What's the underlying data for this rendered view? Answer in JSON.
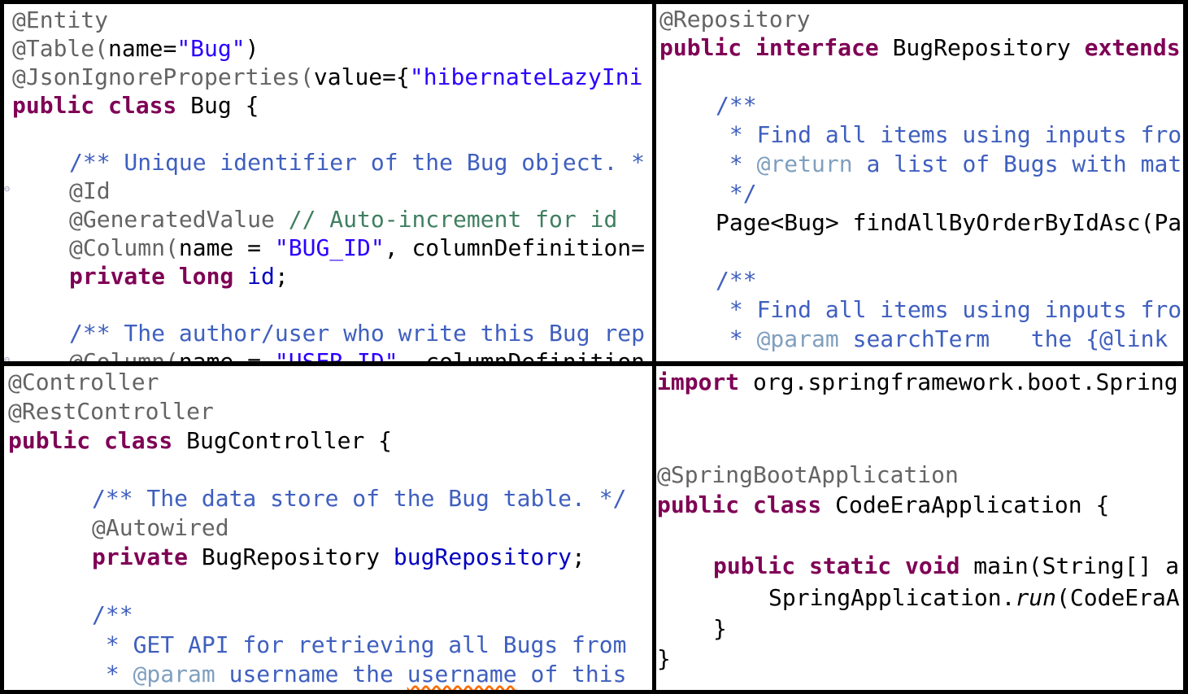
{
  "panels": {
    "entity": {
      "l1": "@Entity",
      "l2a": "@Table(",
      "l2b": "name=",
      "l2c": "\"Bug\"",
      "l2d": ")",
      "l3a": "@JsonIgnoreProperties(",
      "l3b": "value={",
      "l3c": "\"hibernateLazyIni",
      "l4a": "public class",
      "l4b": " Bug {",
      "l5": "/** Unique identifier of the Bug object. *",
      "l6": "@Id",
      "l7a": "@GeneratedValue",
      "l7b": " // Auto-increment for id",
      "l8a": "@Column(",
      "l8b": "name = ",
      "l8c": "\"BUG_ID\"",
      "l8d": ", columnDefinition=",
      "l9a": "private long",
      "l9b": " id",
      "l9c": ";",
      "l10": "/** The author/user who write this Bug rep",
      "l11a": "@Column(",
      "l11b": "name = ",
      "l11c": "\"USER_ID\"",
      "l11d": ", columnDefinition"
    },
    "repository": {
      "l1": "@Repository",
      "l2a": "public interface",
      "l2b": " BugRepository ",
      "l2c": "extends",
      "l3": "/**",
      "l4": " * Find all items using inputs fro",
      "l5a": " * ",
      "l5b": "@return",
      "l5c": " a list of Bugs with mat",
      "l6": " */",
      "l7": "Page<Bug> findAllByOrderByIdAsc(Pa",
      "l8": "/**",
      "l9": " * Find all items using inputs fro",
      "l10a": " * ",
      "l10b": "@param",
      "l10c": " searchTerm   the {@link "
    },
    "controller": {
      "l1": "@Controller",
      "l2": "@RestController",
      "l3a": "public class",
      "l3b": " BugController {",
      "l4": "/** The data store of the Bug table. */",
      "l5": "@Autowired",
      "l6a": "private",
      "l6b": " BugRepository ",
      "l6c": "bugRepository",
      "l6d": ";",
      "l7": "/**",
      "l8": " * GET API for retrieving all Bugs from",
      "l9a": " * ",
      "l9b": "@param",
      "l9c": " username the ",
      "l9d": "username",
      "l9e": " of this"
    },
    "application": {
      "l1a": "import",
      "l1b": " org.springframework.boot.Spring",
      "l2": "@SpringBootApplication",
      "l3a": "public class",
      "l3b": " CodeEraApplication {",
      "l4a": "public static void",
      "l4b": " main(String[] a",
      "l5a": "SpringApplication.",
      "l5b": "run",
      "l5c": "(CodeEraA",
      "l6": "}",
      "l7": "}"
    }
  }
}
